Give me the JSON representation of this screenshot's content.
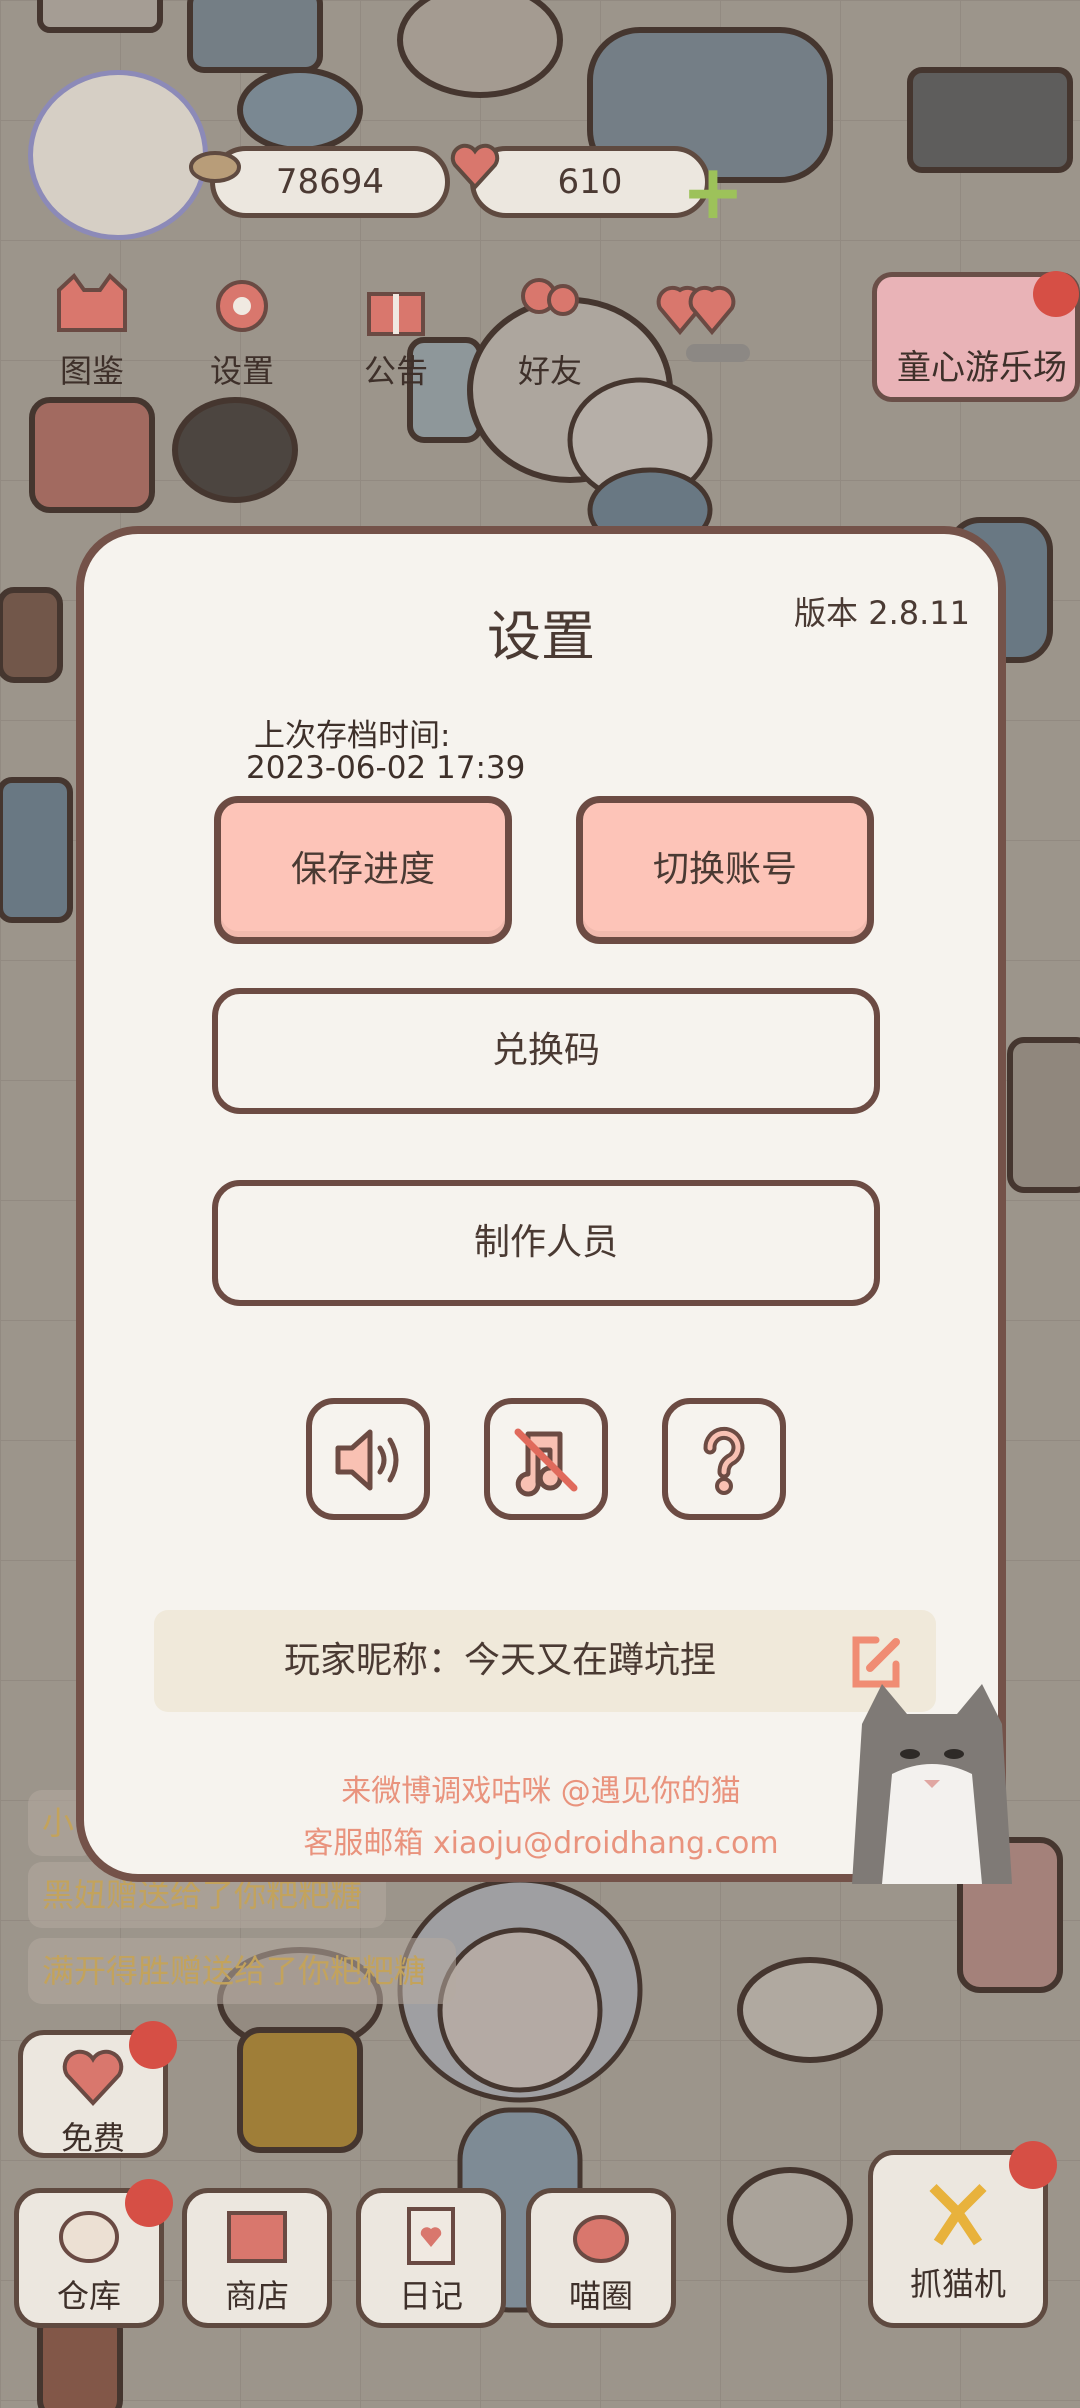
{
  "hud": {
    "coins": "78694",
    "hearts": "610"
  },
  "menu": {
    "items": [
      {
        "label": "图鉴",
        "icon": "cat-face-icon"
      },
      {
        "label": "设置",
        "icon": "gear-icon"
      },
      {
        "label": "公告",
        "icon": "gift-icon"
      },
      {
        "label": "好友",
        "icon": "friends-icon"
      }
    ],
    "banner_label": "童心游乐场"
  },
  "chat": {
    "lines": [
      "小",
      "黑妞赠送给了你粑粑糖",
      "满开得胜赠送给了你粑粑糖"
    ]
  },
  "free_label": "免费",
  "nav": {
    "items": [
      "仓库",
      "商店",
      "日记",
      "喵圈"
    ],
    "claw_label": "抓猫机"
  },
  "settings": {
    "title": "设置",
    "version": "版本 2.8.11",
    "save_time_label": "上次存档时间:",
    "save_time": "2023-06-02 17:39",
    "save_button": "保存进度",
    "switch_account_button": "切换账号",
    "redeem_code_button": "兑换码",
    "credits_button": "制作人员",
    "icons": [
      "sound-on-icon",
      "music-off-icon",
      "help-icon"
    ],
    "nickname": "玩家昵称：今天又在蹲坑捏",
    "weibo": "来微博调戏咕咪 @遇见你的猫",
    "email": "客服邮箱 xiaoju@droidhang.com"
  },
  "colors": {
    "primary_button": "#fdc4b8",
    "border": "#6c4b43",
    "panel": "#f6f3ee",
    "accent_text": "#e9937d"
  }
}
